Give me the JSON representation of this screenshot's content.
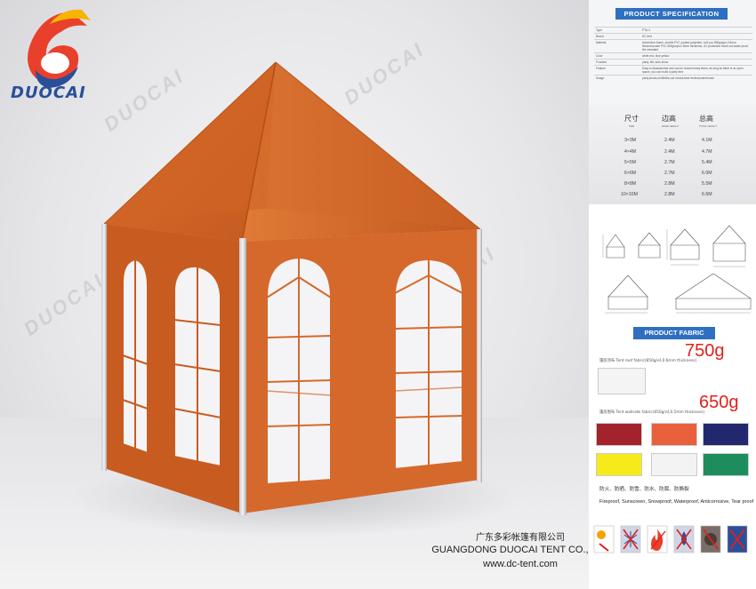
{
  "brand": {
    "name": "DUOCAI",
    "watermark": "DUOCAI"
  },
  "company": {
    "name_cn": "广东多彩帐篷有限公司",
    "name_en": "GUANGDONG DUOCAI TENT CO., LTD",
    "website": "www.dc-tent.com"
  },
  "spec": {
    "title": "PRODUCT SPECIFICATION",
    "rows": [
      {
        "key": "Type",
        "value": "PTA-4"
      },
      {
        "key": "Brand",
        "value": "DC tent"
      },
      {
        "key": "Material",
        "value": "Aluminium frame, double PVC-coated polyester, roof pvc 850g/sqm,0.6mm thickness,side PVC 650g/sqm,0.5mm thickness, UV protection block out,water-proof, fire retardant"
      },
      {
        "key": "Color",
        "value": "white,red, blue,yellow"
      },
      {
        "key": "Function",
        "value": "party, fair, auto show"
      },
      {
        "key": "Feature",
        "value": "Easy to disassemble and can be reused many times; as long as there is an open space, you can build a party tent"
      },
      {
        "key": "Usage",
        "value": "party,shows,exhibition,car shows,beer festival,warehouse"
      }
    ]
  },
  "sizes": {
    "headers": [
      "尺寸",
      "边高",
      "总高"
    ],
    "subheaders": [
      "SIZE",
      "EDGE HEIGHT",
      "TOTAL HEIGHT"
    ],
    "rows": [
      [
        "3×3M",
        "2.4M",
        "4.1M"
      ],
      [
        "4×4M",
        "2.4M",
        "4.7M"
      ],
      [
        "5×5M",
        "2.7M",
        "5.4M"
      ],
      [
        "6×6M",
        "2.7M",
        "6.0M"
      ],
      [
        "8×8M",
        "2.8M",
        "5.5M"
      ],
      [
        "10×10M",
        "2.8M",
        "6.6M"
      ]
    ]
  },
  "fabric": {
    "title": "PRODUCT FABRIC",
    "roof_weight": "750g",
    "roof_label": "篷房顶布  Tent roof fabric(850g/㎡,0.6mm thickness)",
    "wall_weight": "650g",
    "wall_label": "篷房围布  Tent wallside fabric(650g/㎡,0.5mm thickness)",
    "swatches": [
      {
        "name": "roof-white",
        "color": "#f4f4f4"
      },
      {
        "name": "dark-red",
        "color": "#a3232c"
      },
      {
        "name": "orange",
        "color": "#e8603c"
      },
      {
        "name": "navy",
        "color": "#23276e"
      },
      {
        "name": "yellow",
        "color": "#f6ea1b"
      },
      {
        "name": "white",
        "color": "#f3f3f3"
      },
      {
        "name": "green",
        "color": "#1e8d5e"
      }
    ],
    "properties_cn": "防火、防晒、防雪、防水、防腐、防撕裂",
    "properties_en": "Fireproof, Sunscreen, Snowproof, Waterproof, Anticorrosive, Tear proof",
    "icons": [
      "sun-icon",
      "no-snow-icon",
      "fire-icon",
      "no-water-icon",
      "corrosion-icon",
      "no-tear-icon"
    ]
  },
  "colors": {
    "tent": "#d5692c",
    "accent": "#2f6fc1",
    "highlight": "#e3201a"
  }
}
